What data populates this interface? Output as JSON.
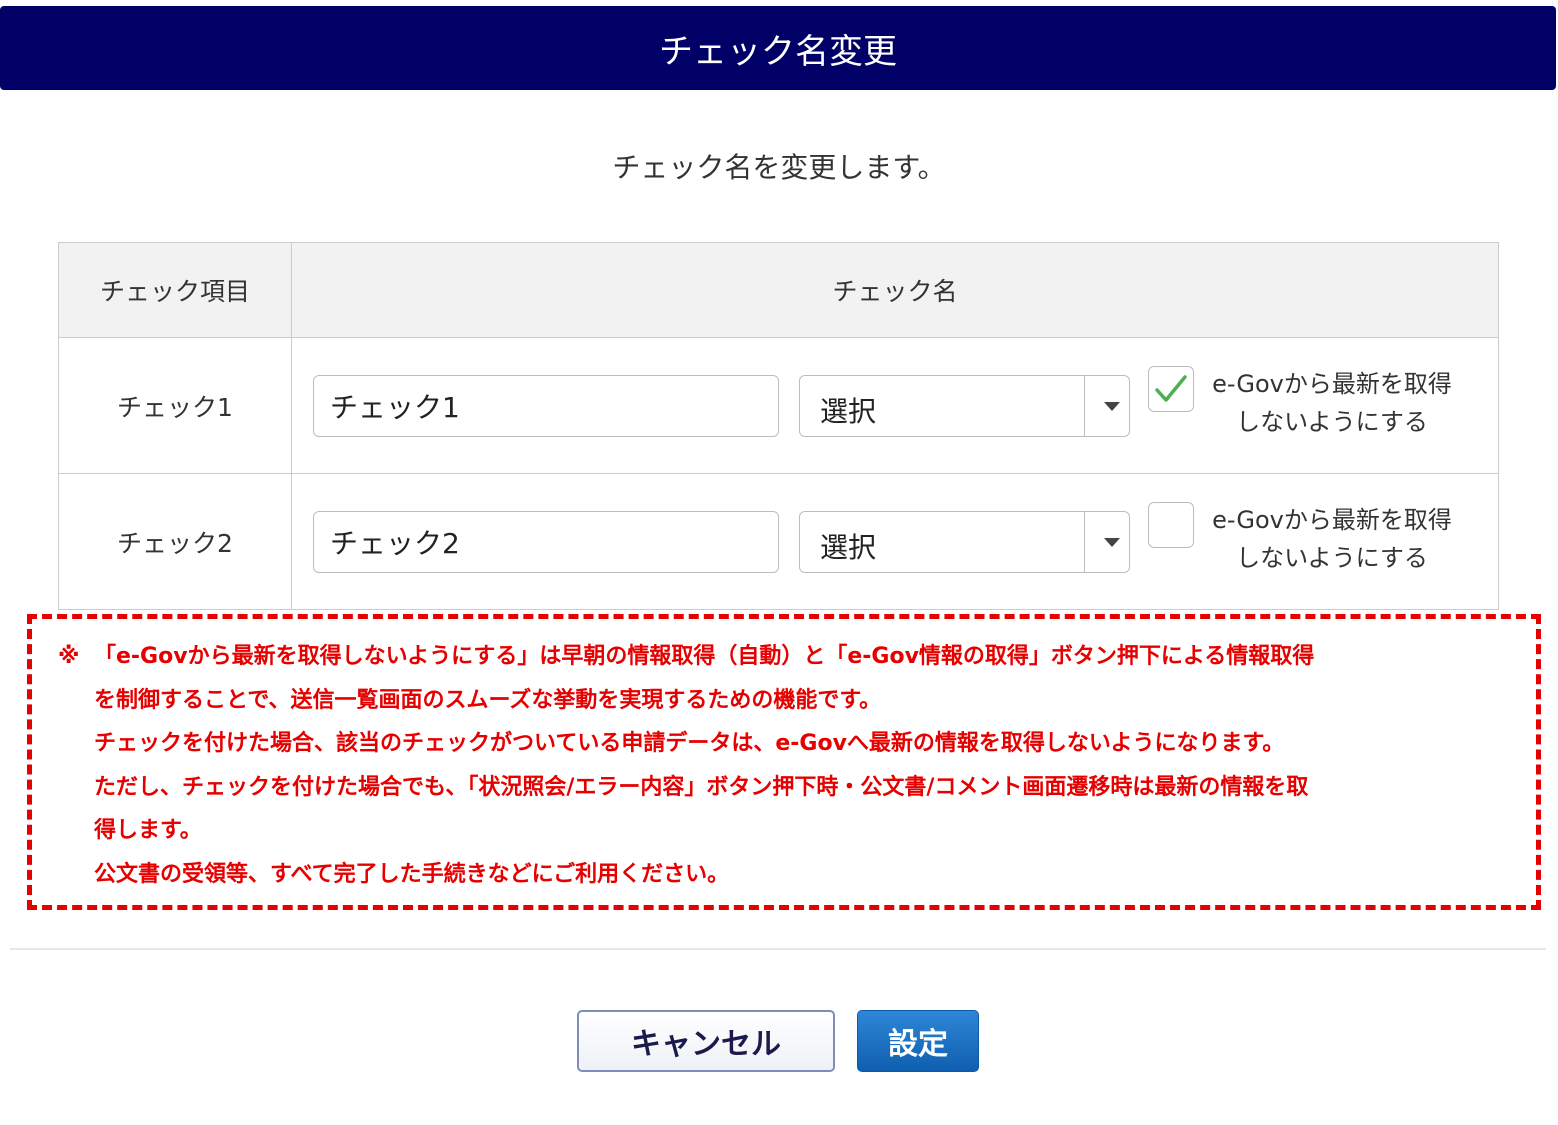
{
  "header": {
    "title": "チェック名変更"
  },
  "subtitle": "チェック名を変更します。",
  "table": {
    "col_item": "チェック項目",
    "col_name": "チェック名",
    "rows": [
      {
        "item": "チェック1",
        "name_value": "チェック1",
        "select_value": "選択",
        "checked": true,
        "check_label_line1": "e-Govから最新を取得",
        "check_label_line2": "しないようにする"
      },
      {
        "item": "チェック2",
        "name_value": "チェック2",
        "select_value": "選択",
        "checked": false,
        "check_label_line1": "e-Govから最新を取得",
        "check_label_line2": "しないようにする"
      }
    ]
  },
  "notice": {
    "mark": "※",
    "lines": [
      "「e-Govから最新を取得しないようにする」は早朝の情報取得（自動）と「e-Gov情報の取得」ボタン押下による情報取得",
      "を制御することで、送信一覧画面のスムーズな挙動を実現するための機能です。",
      "チェックを付けた場合、該当のチェックがついている申請データは、e-Govへ最新の情報を取得しないようになります。",
      "ただし、チェックを付けた場合でも、「状況照会/エラー内容」ボタン押下時・公文書/コメント画面遷移時は最新の情報を取",
      "得します。",
      "公文書の受領等、すべて完了した手続きなどにご利用ください。"
    ]
  },
  "buttons": {
    "cancel": "キャンセル",
    "ok": "設定"
  },
  "colors": {
    "header_bg": "#000066",
    "notice": "#e60000",
    "check": "#4caf50",
    "ok_button": "#0f5fb0"
  },
  "icons": {
    "check": "checkmark-icon",
    "dropdown": "caret-down-icon"
  }
}
